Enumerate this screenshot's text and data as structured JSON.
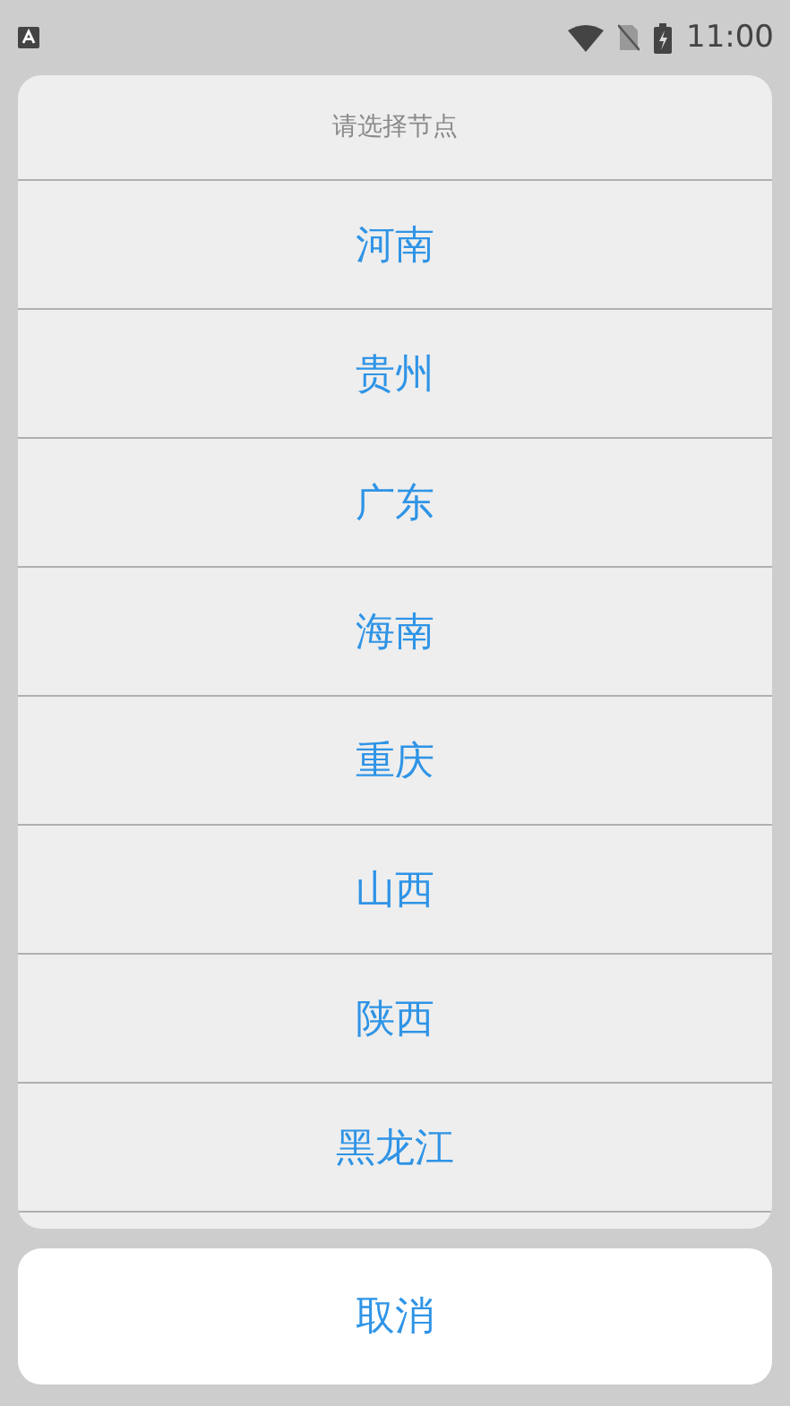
{
  "status_bar": {
    "time": "11:00"
  },
  "sheet": {
    "title": "请选择节点",
    "options": [
      {
        "label": "河南"
      },
      {
        "label": "贵州"
      },
      {
        "label": "广东"
      },
      {
        "label": "海南"
      },
      {
        "label": "重庆"
      },
      {
        "label": "山西"
      },
      {
        "label": "陕西"
      },
      {
        "label": "黑龙江"
      }
    ]
  },
  "cancel_button": {
    "label": "取消"
  }
}
